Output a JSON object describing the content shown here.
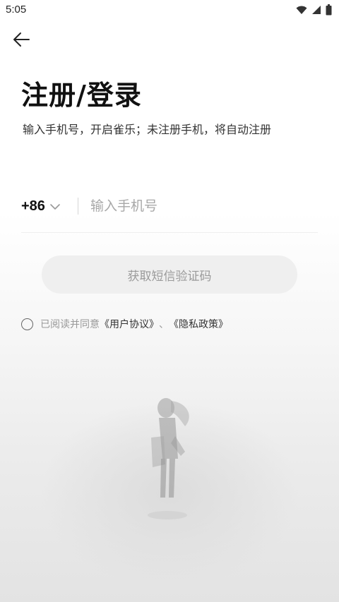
{
  "status_bar": {
    "time": "5:05"
  },
  "header": {
    "title": "注册/登录",
    "subtitle": "输入手机号，开启雀乐；未注册手机，将自动注册"
  },
  "phone": {
    "country_code": "+86",
    "placeholder": "输入手机号",
    "value": ""
  },
  "sms_button": {
    "label": "获取短信验证码"
  },
  "agreement": {
    "prefix": "已阅读并同意",
    "user_agreement": "《用户协议》",
    "separator": "、",
    "privacy_policy": "《隐私政策》"
  },
  "icons": {
    "back": "back-arrow-icon",
    "wifi": "wifi-icon",
    "signal": "signal-icon",
    "battery": "battery-icon",
    "dropdown": "chevron-down-icon"
  },
  "colors": {
    "button_bg": "#efefef",
    "button_text": "#9a9a9a",
    "title": "#111111"
  }
}
